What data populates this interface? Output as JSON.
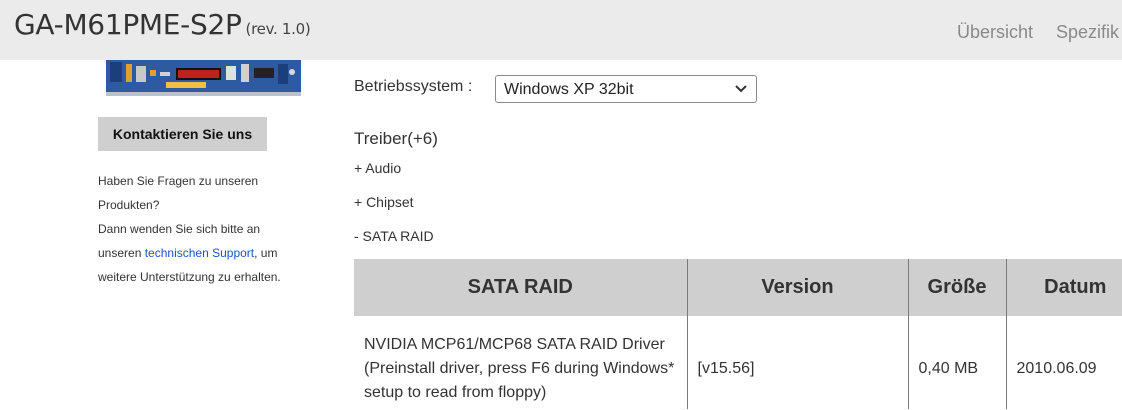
{
  "header": {
    "model": "GA-M61PME-S2P",
    "revision": "(rev. 1.0)",
    "nav": [
      "Übersicht",
      "Spezifik"
    ]
  },
  "sidebar": {
    "contact_button": "Kontaktieren Sie uns",
    "help_text_1": "Haben Sie Fragen zu unseren Produkten?",
    "help_text_2": "Dann wenden Sie sich bitte an unseren",
    "help_link": "technischen Support",
    "help_text_3": ", um weitere Unterstützung zu erhalten."
  },
  "filter": {
    "os_label": "Betriebssystem :",
    "os_selected": "Windows XP 32bit"
  },
  "drivers": {
    "heading": "Treiber(+6)",
    "categories": [
      "+ Audio",
      "+ Chipset",
      "- SATA RAID"
    ]
  },
  "table": {
    "headers": [
      "SATA RAID",
      "Version",
      "Größe",
      "Datum"
    ],
    "rows": [
      {
        "name": "NVIDIA MCP61/MCP68 SATA RAID Driver (Preinstall driver, press F6 during Windows* setup to read from floppy)",
        "version": "[v15.56]",
        "size": "0,40 MB",
        "date": "2010.06.09"
      }
    ]
  },
  "colors": {
    "topbar": "#ebebeb",
    "table_header": "#cfcfcf",
    "link": "#1a56c0"
  }
}
